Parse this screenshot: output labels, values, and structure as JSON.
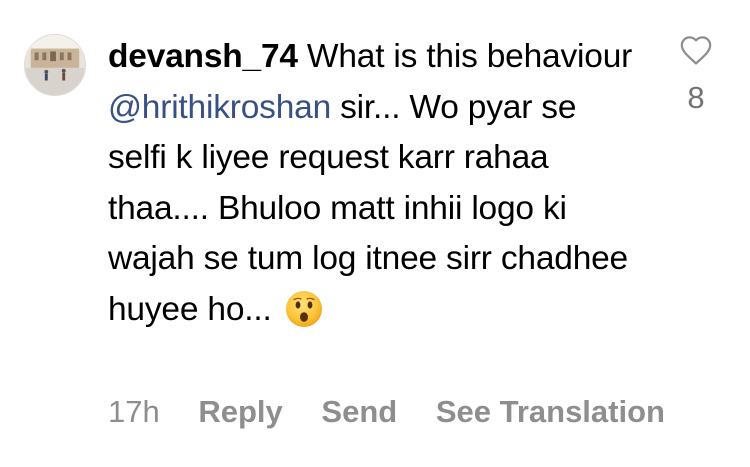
{
  "comment": {
    "username": "devansh_74",
    "text_before_mention": " What is this behaviour ",
    "mention": "@hrithikroshan",
    "text_after_mention": " sir... Wo pyar se selfi k liyee request karr rahaa thaa.... Bhuloo matt inhii logo ki wajah se tum log itnee sirr chadhee huyee ho... ",
    "emoji": "hushed-face"
  },
  "like": {
    "icon": "heart-outline-icon",
    "count": "8"
  },
  "meta": {
    "time": "17h",
    "reply_label": "Reply",
    "send_label": "Send",
    "translate_label": "See Translation"
  },
  "colors": {
    "mention": "#385185",
    "meta_text": "#8e8e8e",
    "like_count": "#737373"
  }
}
